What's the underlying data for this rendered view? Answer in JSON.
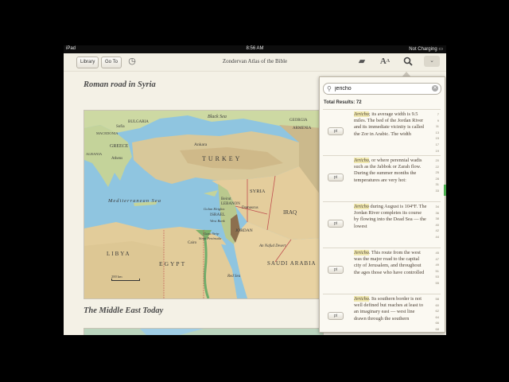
{
  "status_bar": {
    "device": "iPad",
    "time": "8:56 AM",
    "battery": "Not Charging"
  },
  "toolbar": {
    "library_label": "Library",
    "goto_label": "Go To",
    "title": "Zondervan Atlas of the Bible",
    "font_icon_label": "A"
  },
  "content": {
    "heading1": "Roman road in Syria",
    "heading2": "The Middle East Today",
    "map1_labels": {
      "bulgaria": "BULGARIA",
      "sofia": "Sofia",
      "macedonia": "MACEDONIA",
      "greece": "GREECE",
      "albania": "ALBANIA",
      "athens": "Athens",
      "black_sea": "Black Sea",
      "ankara": "Ankara",
      "turkey": "TURKEY",
      "georgia": "GEORGIA",
      "armenia": "ARMENIA",
      "syria": "SYRIA",
      "lebanon": "LEBANON",
      "beirut": "Beirut",
      "israel": "ISRAEL",
      "damascus": "Damascus",
      "jordan": "JORDAN",
      "iraq": "IRAQ",
      "med_sea": "Mediterranean Sea",
      "libya": "LIBYA",
      "egypt": "EGYPT",
      "cairo": "Cairo",
      "saudi": "SAUDI ARABIA",
      "nafud": "An Nafud Desert",
      "red_sea": "Red Sea",
      "west_bank": "West Bank",
      "gaza": "Gaza Strip",
      "golan": "Golan Heights",
      "sinai": "Sinai Peninsula",
      "scale": "200 km"
    }
  },
  "search": {
    "query": "jericho",
    "total_results": "Total Results: 72",
    "results": [
      {
        "text_hl": "Jericho",
        "text": "; its average width is 9.5 miles. The bed of the Jordan River and its immediate vicinity is called the Zor in Arabic. The width",
        "nums": "7 9 11 13 15 17 19",
        "btn": "pt"
      },
      {
        "text_hl": "Jericho",
        "text": ", or where perennial wadis such as the Jabbok or Zarah flow. During the summer months the temperatures are very hot:",
        "nums": "20 22 25 28 31 33",
        "btn": "pt"
      },
      {
        "text_hl": "Jericho",
        "text": " during August is 104°F. The Jordan River completes its course by flowing into the Dead Sea — the lowest",
        "nums": "34 36 38 40 42 44",
        "btn": "pt"
      },
      {
        "text_hl": "Jericho",
        "text": ". This route from the west was the major road to the capital city of Jerusalem, and throughout the ages those who have controlled",
        "nums": "45 47 49 51 53 55",
        "btn": "pt"
      },
      {
        "text_hl": "Jericho",
        "text": ". Its southern border is not well defined but reaches at least to an imaginary east — west line drawn through the southern",
        "nums": "58 60 62 64 66 68 70",
        "btn": "pt"
      }
    ]
  },
  "colors": {
    "sea": "#8fc5e0",
    "land": "#c8d4a2",
    "desert": "#e6cfa1",
    "mountain": "#b79a6e",
    "highlight": "#f0e8b0",
    "accent": "#4caf50"
  }
}
